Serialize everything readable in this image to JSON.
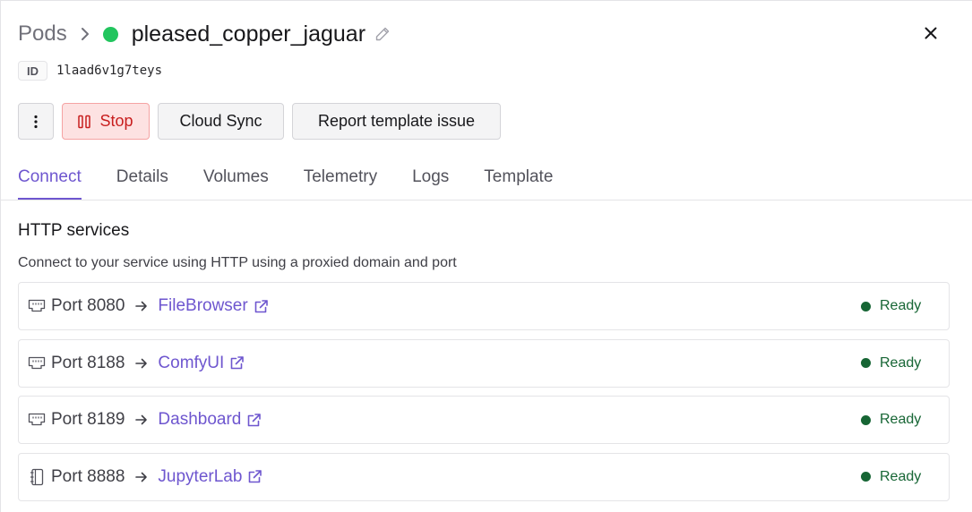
{
  "breadcrumb": {
    "root": "Pods",
    "pod_name": "pleased_copper_jaguar",
    "status_color": "#22c55e"
  },
  "pod_id": {
    "label": "ID",
    "value": "1laad6v1g7teys"
  },
  "actions": {
    "more_icon": "vertical-ellipsis-icon",
    "stop_label": "Stop",
    "cloud_sync_label": "Cloud Sync",
    "report_label": "Report template issue"
  },
  "tabs": [
    {
      "label": "Connect",
      "active": true
    },
    {
      "label": "Details",
      "active": false
    },
    {
      "label": "Volumes",
      "active": false
    },
    {
      "label": "Telemetry",
      "active": false
    },
    {
      "label": "Logs",
      "active": false
    },
    {
      "label": "Template",
      "active": false
    }
  ],
  "http_services": {
    "title": "HTTP services",
    "description": "Connect to your service using HTTP using a proxied domain and port",
    "items": [
      {
        "icon": "ethernet-port-icon",
        "port": "Port 8080",
        "name": "FileBrowser",
        "status": "Ready"
      },
      {
        "icon": "ethernet-port-icon",
        "port": "Port 8188",
        "name": "ComfyUI",
        "status": "Ready"
      },
      {
        "icon": "ethernet-port-icon",
        "port": "Port 8189",
        "name": "Dashboard",
        "status": "Ready"
      },
      {
        "icon": "notebook-icon",
        "port": "Port 8888",
        "name": "JupyterLab",
        "status": "Ready"
      }
    ]
  },
  "colors": {
    "accent": "#6e56cf",
    "ready": "#166534",
    "stop_bg": "#fde2e2",
    "stop_text": "#c81e1e"
  }
}
